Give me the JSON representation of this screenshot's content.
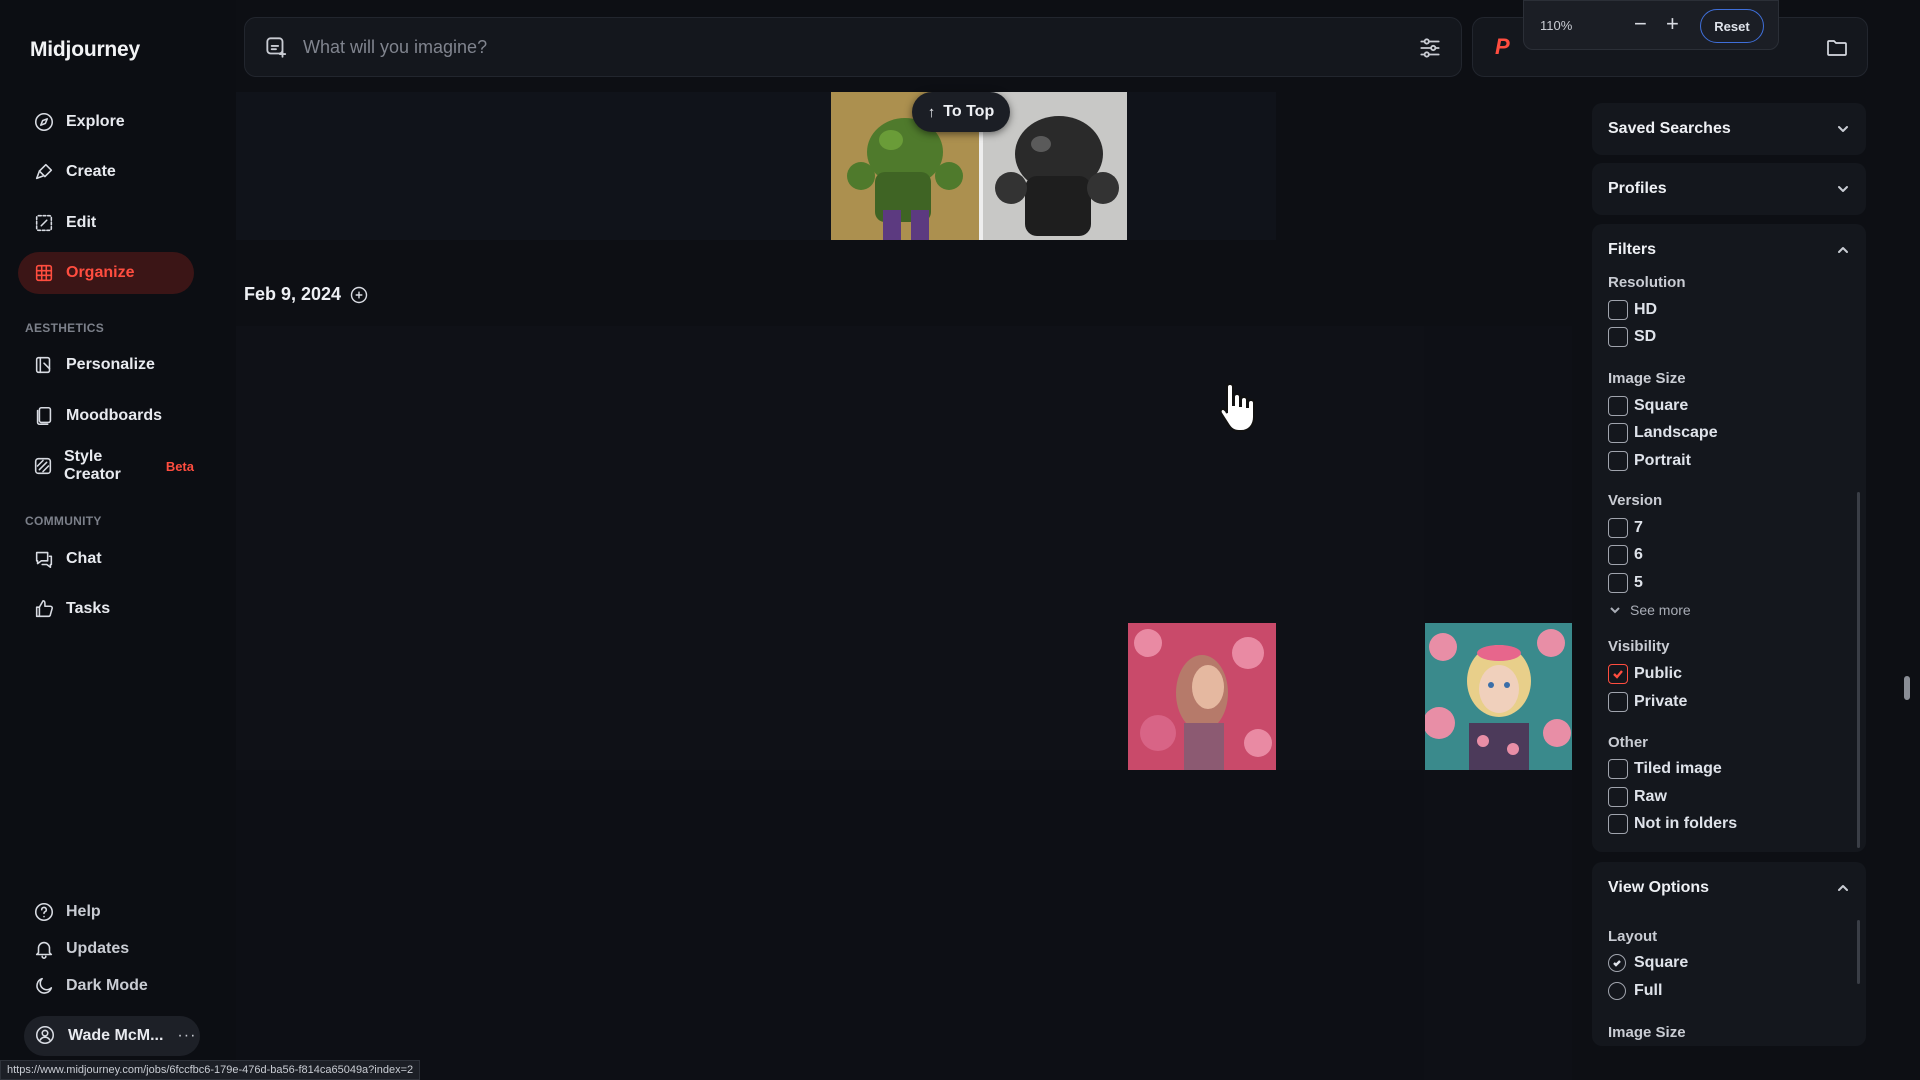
{
  "app": {
    "title": "Midjourney"
  },
  "sidebar": {
    "nav": [
      {
        "label": "Explore",
        "icon": "compass-icon"
      },
      {
        "label": "Create",
        "icon": "brush-icon"
      },
      {
        "label": "Edit",
        "icon": "edit-icon"
      },
      {
        "label": "Organize",
        "icon": "grid-icon",
        "active": true
      }
    ],
    "aesthetics_label": "AESTHETICS",
    "aesthetics": [
      {
        "label": "Personalize",
        "icon": "personalize-icon"
      },
      {
        "label": "Moodboards",
        "icon": "moodboards-icon"
      },
      {
        "label": "Style Creator",
        "icon": "style-creator-icon",
        "badge": "Beta"
      }
    ],
    "community_label": "COMMUNITY",
    "community": [
      {
        "label": "Chat",
        "icon": "chat-icon"
      },
      {
        "label": "Tasks",
        "icon": "thumbs-up-icon"
      }
    ],
    "bottom": [
      {
        "label": "Help",
        "icon": "help-icon"
      },
      {
        "label": "Updates",
        "icon": "bell-icon"
      },
      {
        "label": "Dark Mode",
        "icon": "moon-icon"
      }
    ],
    "user": {
      "name": "Wade McM...",
      "more": "···"
    }
  },
  "search": {
    "placeholder": "What will you imagine?"
  },
  "zoom": {
    "percent": "110%",
    "minus": "−",
    "plus": "+",
    "reset": "Reset"
  },
  "main": {
    "to_top": "To Top",
    "date": "Feb 9, 2024"
  },
  "panel": {
    "saved_searches": "Saved Searches",
    "profiles": "Profiles",
    "filters": {
      "title": "Filters",
      "resolution": {
        "title": "Resolution",
        "options": [
          "HD",
          "SD"
        ]
      },
      "image_size": {
        "title": "Image Size",
        "options": [
          "Square",
          "Landscape",
          "Portrait"
        ]
      },
      "version": {
        "title": "Version",
        "options": [
          "7",
          "6",
          "5"
        ],
        "see_more": "See more"
      },
      "visibility": {
        "title": "Visibility",
        "options": [
          "Public",
          "Private"
        ],
        "checked": "Public"
      },
      "other": {
        "title": "Other",
        "options": [
          "Tiled image",
          "Raw",
          "Not in folders"
        ]
      }
    },
    "view_options": {
      "title": "View Options",
      "layout": {
        "title": "Layout",
        "options": [
          "Square",
          "Full"
        ],
        "selected": "Square"
      },
      "image_size_title": "Image Size"
    }
  },
  "status_url": "https://www.midjourney.com/jobs/6fccfbc6-179e-476d-ba56-f814ca65049a?index=2",
  "colors": {
    "accent": "#ff4d3f",
    "background": "#0d0f14",
    "panel": "#14171d"
  }
}
